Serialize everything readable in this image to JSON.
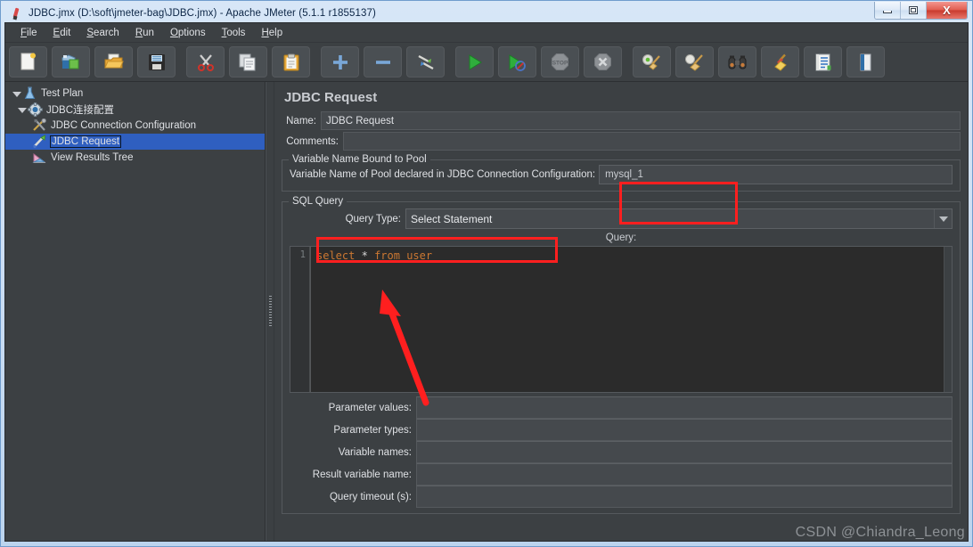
{
  "window": {
    "title": "JDBC.jmx (D:\\soft\\jmeter-bag\\JDBC.jmx) - Apache JMeter (5.1.1 r1855137)",
    "app_icon": "jmeter-feather-icon",
    "controls": {
      "minimize": "minimize-icon",
      "restore": "restore-icon",
      "close": "X"
    }
  },
  "menu": {
    "items": [
      {
        "label": "File"
      },
      {
        "label": "Edit"
      },
      {
        "label": "Search"
      },
      {
        "label": "Run"
      },
      {
        "label": "Options"
      },
      {
        "label": "Tools"
      },
      {
        "label": "Help"
      }
    ]
  },
  "toolbar": {
    "buttons": [
      {
        "name": "new-test-plan-button",
        "icon": "new-document-icon"
      },
      {
        "name": "templates-button",
        "icon": "templates-folders-icon"
      },
      {
        "name": "open-button",
        "icon": "open-folder-icon"
      },
      {
        "name": "save-button",
        "icon": "floppy-disk-icon"
      },
      {
        "name": "cut-button",
        "icon": "scissors-icon"
      },
      {
        "name": "copy-button",
        "icon": "copy-pages-icon"
      },
      {
        "name": "paste-button",
        "icon": "clipboard-icon"
      },
      {
        "name": "expand-all-button",
        "icon": "plus-icon"
      },
      {
        "name": "collapse-all-button",
        "icon": "minus-icon"
      },
      {
        "name": "toggle-button",
        "icon": "toggle-pencils-icon"
      },
      {
        "name": "start-button",
        "icon": "green-play-icon"
      },
      {
        "name": "start-no-pauses-button",
        "icon": "play-no-pause-icon"
      },
      {
        "name": "stop-button",
        "icon": "stop-octagon-icon"
      },
      {
        "name": "shutdown-button",
        "icon": "shutdown-x-icon"
      },
      {
        "name": "clear-button",
        "icon": "gear-broom-icon"
      },
      {
        "name": "clear-all-button",
        "icon": "clear-all-broom-icon"
      },
      {
        "name": "search-button",
        "icon": "binoculars-icon"
      },
      {
        "name": "reset-search-button",
        "icon": "yellow-broom-icon"
      },
      {
        "name": "function-helper-button",
        "icon": "notepad-lines-icon"
      },
      {
        "name": "help-button",
        "icon": "book-icon"
      }
    ]
  },
  "tree": {
    "nodes": [
      {
        "label": "Test Plan",
        "icon": "test-plan-flask-icon",
        "level": 0,
        "expanded": true,
        "selected": false
      },
      {
        "label": "JDBC连接配置",
        "icon": "thread-group-gear-icon",
        "level": 1,
        "expanded": true,
        "selected": false
      },
      {
        "label": "JDBC Connection Configuration",
        "icon": "config-tools-icon",
        "level": 2,
        "expanded": false,
        "selected": false
      },
      {
        "label": "JDBC Request",
        "icon": "jdbc-request-pipette-icon",
        "level": 2,
        "expanded": false,
        "selected": true
      },
      {
        "label": "View Results Tree",
        "icon": "view-results-tree-icon",
        "level": 2,
        "expanded": false,
        "selected": false
      }
    ]
  },
  "main": {
    "panel_title": "JDBC Request",
    "name_label": "Name:",
    "name_value": "JDBC Request",
    "comments_label": "Comments:",
    "comments_value": "",
    "pool_group": {
      "title": "Variable Name Bound to Pool",
      "label": "Variable Name of Pool declared in JDBC Connection Configuration:",
      "value": "mysql_1"
    },
    "sql_group": {
      "title": "SQL Query",
      "query_type_label": "Query Type:",
      "query_type_value": "Select Statement",
      "query_caption": "Query:",
      "editor": {
        "line_number": "1",
        "tokens": [
          {
            "text": "select",
            "type": "keyword"
          },
          {
            "text": " ",
            "type": "plain"
          },
          {
            "text": "*",
            "type": "operator"
          },
          {
            "text": " ",
            "type": "plain"
          },
          {
            "text": "from",
            "type": "keyword"
          },
          {
            "text": " ",
            "type": "plain"
          },
          {
            "text": "user",
            "type": "identifier"
          }
        ],
        "full_text": "select * from user"
      },
      "fields": [
        {
          "label": "Parameter values:",
          "value": ""
        },
        {
          "label": "Parameter types:",
          "value": ""
        },
        {
          "label": "Variable names:",
          "value": ""
        },
        {
          "label": "Result variable name:",
          "value": ""
        },
        {
          "label": "Query timeout (s):",
          "value": ""
        }
      ]
    }
  },
  "annotations": {
    "boxes": [
      {
        "name": "pool-variable-highlight",
        "color": "#ff1f1f"
      },
      {
        "name": "query-type-highlight",
        "color": "#ff1f1f"
      }
    ],
    "arrow": {
      "name": "query-pointer-arrow",
      "color": "#ff1f1f"
    }
  },
  "watermark": {
    "text": "CSDN @Chiandra_Leong"
  },
  "colors": {
    "window_bg": "#3c4043",
    "titlebar_bg": "#cfe0f4",
    "selection": "#2f5fc0",
    "accent_red": "#ff1f1f",
    "editor_bg": "#2b2b2b",
    "keyword": "#cc7832"
  }
}
